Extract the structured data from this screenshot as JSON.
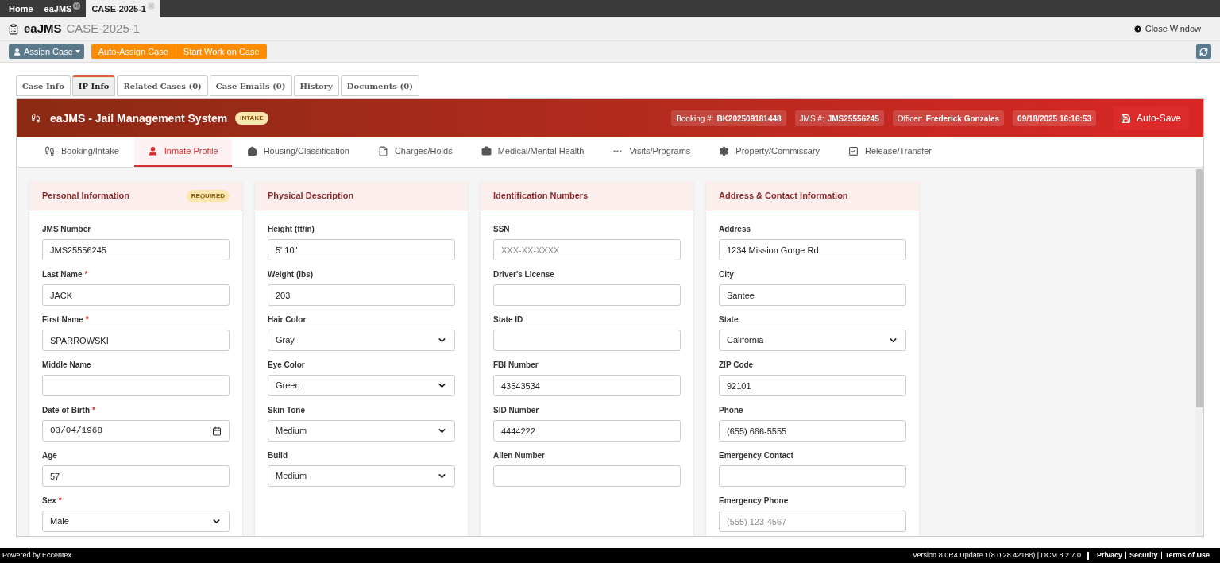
{
  "app_tabs": [
    {
      "label": "Home",
      "selected": false,
      "closable": false
    },
    {
      "label": "eaJMS",
      "selected": false,
      "closable": true
    },
    {
      "label": "CASE-2025-1",
      "selected": true,
      "closable": true
    }
  ],
  "header": {
    "app": "eaJMS",
    "case": "CASE-2025-1",
    "close": "Close Window"
  },
  "toolbar": {
    "assign": "Assign Case",
    "actions": [
      "Auto-Assign Case",
      "Start Work on Case"
    ]
  },
  "case_tabs": [
    {
      "label": "Case Info",
      "selected": false
    },
    {
      "label": "IP Info",
      "selected": true
    },
    {
      "label": "Related Cases (0)",
      "selected": false
    },
    {
      "label": "Case Emails (0)",
      "selected": false
    },
    {
      "label": "History",
      "selected": false
    },
    {
      "label": "Documents (0)",
      "selected": false
    }
  ],
  "banner": {
    "title": "eaJMS - Jail Management System",
    "badge": "INTAKE",
    "chips": [
      {
        "label": "Booking #:",
        "value": "BK202509181448"
      },
      {
        "label": "JMS #:",
        "value": "JMS25556245"
      },
      {
        "label": "Officer:",
        "value": "Frederick Gonzales"
      },
      {
        "value": "09/18/2025 16:16:53"
      }
    ],
    "save": "Auto-Save"
  },
  "module_tabs": [
    {
      "label": "Booking/Intake",
      "selected": false
    },
    {
      "label": "Inmate Profile",
      "selected": true
    },
    {
      "label": "Housing/Classification",
      "selected": false
    },
    {
      "label": "Charges/Holds",
      "selected": false
    },
    {
      "label": "Medical/Mental Health",
      "selected": false
    },
    {
      "label": "Visits/Programs",
      "selected": false
    },
    {
      "label": "Property/Commissary",
      "selected": false
    },
    {
      "label": "Release/Transfer",
      "selected": false
    }
  ],
  "cards": [
    {
      "title": "Personal Information",
      "badge": "REQUIRED",
      "fields": [
        {
          "label": "JMS Number",
          "kind": "text",
          "value": "JMS25556245"
        },
        {
          "label": "Last Name",
          "kind": "text",
          "value": "JACK",
          "marker": "*"
        },
        {
          "label": "First Name",
          "kind": "text",
          "value": "SPARROWSKI",
          "marker": "*"
        },
        {
          "label": "Middle Name",
          "kind": "text"
        },
        {
          "label": "Date of Birth",
          "kind": "date",
          "value": "03/04/1968",
          "marker": "*"
        },
        {
          "label": "Age",
          "kind": "text",
          "value": "57"
        },
        {
          "label": "Sex",
          "kind": "select",
          "value": "Male",
          "marker": "*"
        }
      ]
    },
    {
      "title": "Physical Description",
      "fields": [
        {
          "label": "Height (ft/in)",
          "kind": "text",
          "value": "5' 10\""
        },
        {
          "label": "Weight (lbs)",
          "kind": "text",
          "value": "203"
        },
        {
          "label": "Hair Color",
          "kind": "select",
          "value": "Gray"
        },
        {
          "label": "Eye Color",
          "kind": "select",
          "value": "Green"
        },
        {
          "label": "Skin Tone",
          "kind": "select",
          "value": "Medium"
        },
        {
          "label": "Build",
          "kind": "select",
          "value": "Medium"
        }
      ]
    },
    {
      "title": "Identification Numbers",
      "fields": [
        {
          "label": "SSN",
          "kind": "text",
          "placeholder": "XXX-XX-XXXX"
        },
        {
          "label": "Driver's License",
          "kind": "text"
        },
        {
          "label": "State ID",
          "kind": "text"
        },
        {
          "label": "FBI Number",
          "kind": "text",
          "value": "43543534"
        },
        {
          "label": "SID Number",
          "kind": "text",
          "value": "4444222"
        },
        {
          "label": "Alien Number",
          "kind": "text"
        }
      ]
    },
    {
      "title": "Address & Contact Information",
      "fields": [
        {
          "label": "Address",
          "kind": "text",
          "value": "1234 Mission Gorge Rd"
        },
        {
          "label": "City",
          "kind": "text",
          "value": "Santee"
        },
        {
          "label": "State",
          "kind": "select",
          "value": "California"
        },
        {
          "label": "ZIP Code",
          "kind": "text",
          "value": "92101"
        },
        {
          "label": "Phone",
          "kind": "text",
          "value": "(655) 666-5555"
        },
        {
          "label": "Emergency Contact",
          "kind": "text"
        },
        {
          "label": "Emergency Phone",
          "kind": "text",
          "placeholder": "(555) 123-4567"
        }
      ]
    }
  ],
  "footer": {
    "powered": "Powered by Eccentex",
    "version": "Version  8.0R4 Update 1(8.0.28.42188) | DCM 8.2.7.0",
    "links": [
      "Privacy",
      "Security",
      "Terms of Use"
    ]
  }
}
